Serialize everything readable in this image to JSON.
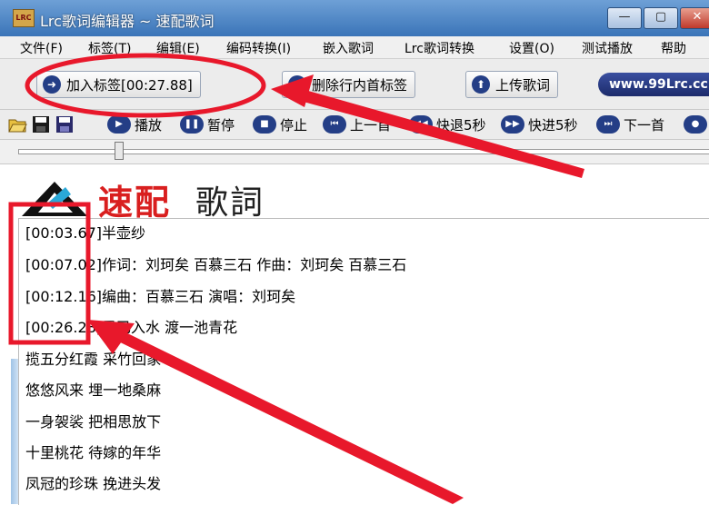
{
  "window": {
    "icon_text": "LRC",
    "title": "Lrc歌词编辑器 ~ 速配歌词",
    "controls": [
      "—",
      "▢",
      "✕"
    ]
  },
  "menu": [
    "文件(F)",
    "标签(T)",
    "编辑(E)",
    "编码转换(I)",
    "嵌入歌词",
    "Lrc歌词转换",
    "设置(O)",
    "测试播放",
    "帮助"
  ],
  "toolbar1": {
    "add_tag": "加入标签[00:27.88]",
    "delete_tag": "删除行内首标签",
    "upload": "上传歌词",
    "website": "www.99Lrc.cc"
  },
  "toolbar2": {
    "play": "播放",
    "pause": "暂停",
    "stop": "停止",
    "prev": "上一首",
    "rewind": "快退5秒",
    "forward": "快进5秒",
    "next": "下一首"
  },
  "slider": {
    "position_fraction": 0.14
  },
  "brand": {
    "red": "速配",
    "black": "歌詞"
  },
  "lyrics": [
    "[00:03.67]半壶纱",
    "[00:07.02]作词：刘珂矣 百慕三石 作曲：刘珂矣 百慕三石",
    "[00:12.16]编曲：百慕三石 演唱：刘珂矣",
    "[00:26.28]墨已入水 渡一池青花",
    "揽五分红霞 采竹回家",
    "悠悠风来 埋一地桑麻",
    "一身袈裟 把相思放下",
    "十里桃花 待嫁的年华",
    "凤冠的珍珠 挽进头发"
  ],
  "colors": {
    "annotation": "#e8182b",
    "accent": "#243e86",
    "title_bar": "#3a74b8"
  }
}
